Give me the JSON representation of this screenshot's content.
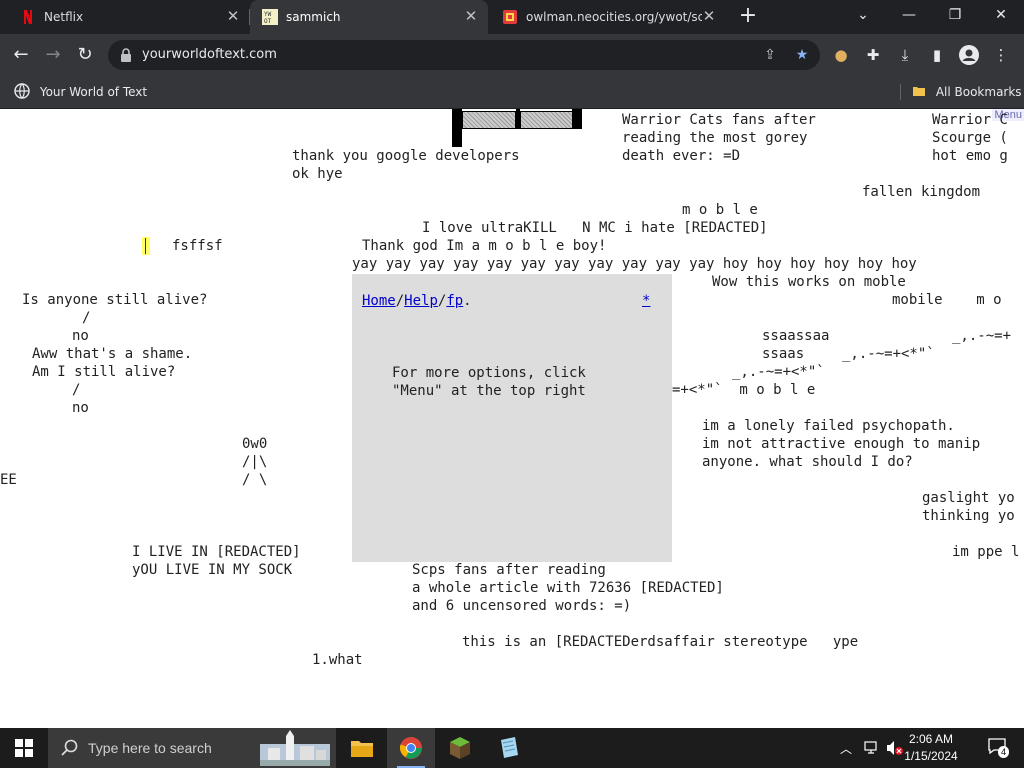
{
  "browser": {
    "tabs": [
      {
        "label": "Netflix",
        "icon": "netflix-icon"
      },
      {
        "label": "sammich",
        "icon": "ywot-icon"
      },
      {
        "label": "owlman.neocities.org/ywot/scrip",
        "icon": "neocities-icon"
      }
    ],
    "url": "yourworldoftext.com",
    "bookmarks": [
      {
        "label": "Your World of Text",
        "icon": "globe-icon"
      },
      {
        "label": "All Bookmarks",
        "icon": "folder-icon"
      }
    ]
  },
  "page": {
    "menu_label": "Menu",
    "texts": [
      "Warrior Cats fans after",
      "reading the most gorey",
      "death ever: =D",
      "Warrior C",
      "Scourge (",
      "hot emo g",
      "thank you google developers",
      "ok hye",
      "fallen kingdom",
      "m o b l e",
      "I love ultraKILL   N MC i hate [REDACTED]",
      "fsffsf",
      "Thank god Im a m o b l e boy!",
      "yay yay yay yay yay yay yay yay yay yay yay hoy hoy hoy hoy hoy hoy",
      "Wow this works on moble",
      "Is anyone still alive?",
      "/",
      "no",
      "Aww that's a shame.",
      "Am I still alive?",
      "/",
      "no",
      "mobile    m o",
      "ssaassaa",
      "_,.-~=+",
      "ssaas",
      "_,.-~=+<*\"`",
      "_,.-~=+<*\"`",
      "=+<*\"`  m o b l e",
      "im a lonely failed psychopath.",
      "im not attractive enough to manip",
      "anyone. what should I do?",
      "0w0",
      "/|\\",
      "/ \\",
      "EE",
      "gaslight yo",
      "thinking yo",
      "I LIVE IN [REDACTED]",
      "yOU LIVE IN MY SOCK",
      "im ppe l",
      "Scps fans after reading",
      "a whole article with 72636 [REDACTED]",
      "and 6 uncensored words: =)",
      "this is an [REDACTEDerdsaffair stereotype   ype",
      "1.what"
    ],
    "panel": {
      "link_home": "Home",
      "link_help": "Help",
      "link_fp": "fp",
      "sep": "/",
      "dot": ".",
      "star": "*",
      "line1": "For more options, click",
      "line2": "\"Menu\" at the top right"
    }
  },
  "taskbar": {
    "search_placeholder": "Type here to search",
    "time": "2:06 AM",
    "date": "1/15/2024",
    "notification_count": "4"
  }
}
